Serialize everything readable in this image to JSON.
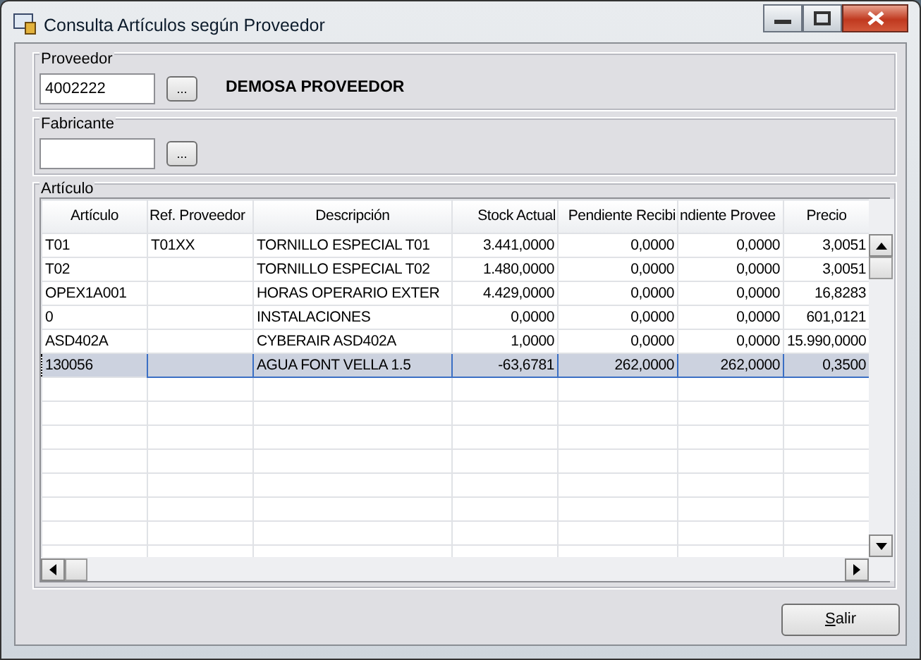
{
  "window": {
    "title": "Consulta Artículos según Proveedor"
  },
  "proveedor": {
    "label": "Proveedor",
    "code": "4002222",
    "browse": "...",
    "name": "DEMOSA PROVEEDOR"
  },
  "fabricante": {
    "label": "Fabricante",
    "browse": "..."
  },
  "articulos": {
    "label": "Artículo",
    "columns": [
      {
        "label": "Artículo"
      },
      {
        "label": "Ref. Proveedor"
      },
      {
        "label": "Descripción"
      },
      {
        "label": "Stock Actual"
      },
      {
        "label": "Pendiente Recibi"
      },
      {
        "label": "ndiente Provee"
      },
      {
        "label": "Precio"
      }
    ],
    "rows": [
      {
        "selected": false,
        "cells": [
          "T01",
          "T01XX",
          "TORNILLO ESPECIAL T01",
          "3.441,0000",
          "0,0000",
          "0,0000",
          "3,0051"
        ]
      },
      {
        "selected": false,
        "cells": [
          "T02",
          "",
          "TORNILLO ESPECIAL T02",
          "1.480,0000",
          "0,0000",
          "0,0000",
          "3,0051"
        ]
      },
      {
        "selected": false,
        "cells": [
          "OPEX1A001",
          "",
          "HORAS OPERARIO EXTER",
          "4.429,0000",
          "0,0000",
          "0,0000",
          "16,8283"
        ]
      },
      {
        "selected": false,
        "cells": [
          "0",
          "",
          "INSTALACIONES",
          "0,0000",
          "0,0000",
          "0,0000",
          "601,0121"
        ]
      },
      {
        "selected": false,
        "cells": [
          "ASD402A",
          "",
          "CYBERAIR ASD402A",
          "1,0000",
          "0,0000",
          "0,0000",
          "15.990,0000"
        ]
      },
      {
        "selected": true,
        "cells": [
          "130056",
          "",
          "AGUA FONT VELLA 1.5",
          "-63,6781",
          "262,0000",
          "262,0000",
          "0,3500"
        ]
      }
    ]
  },
  "buttons": [
    {
      "label": "Salir"
    }
  ]
}
